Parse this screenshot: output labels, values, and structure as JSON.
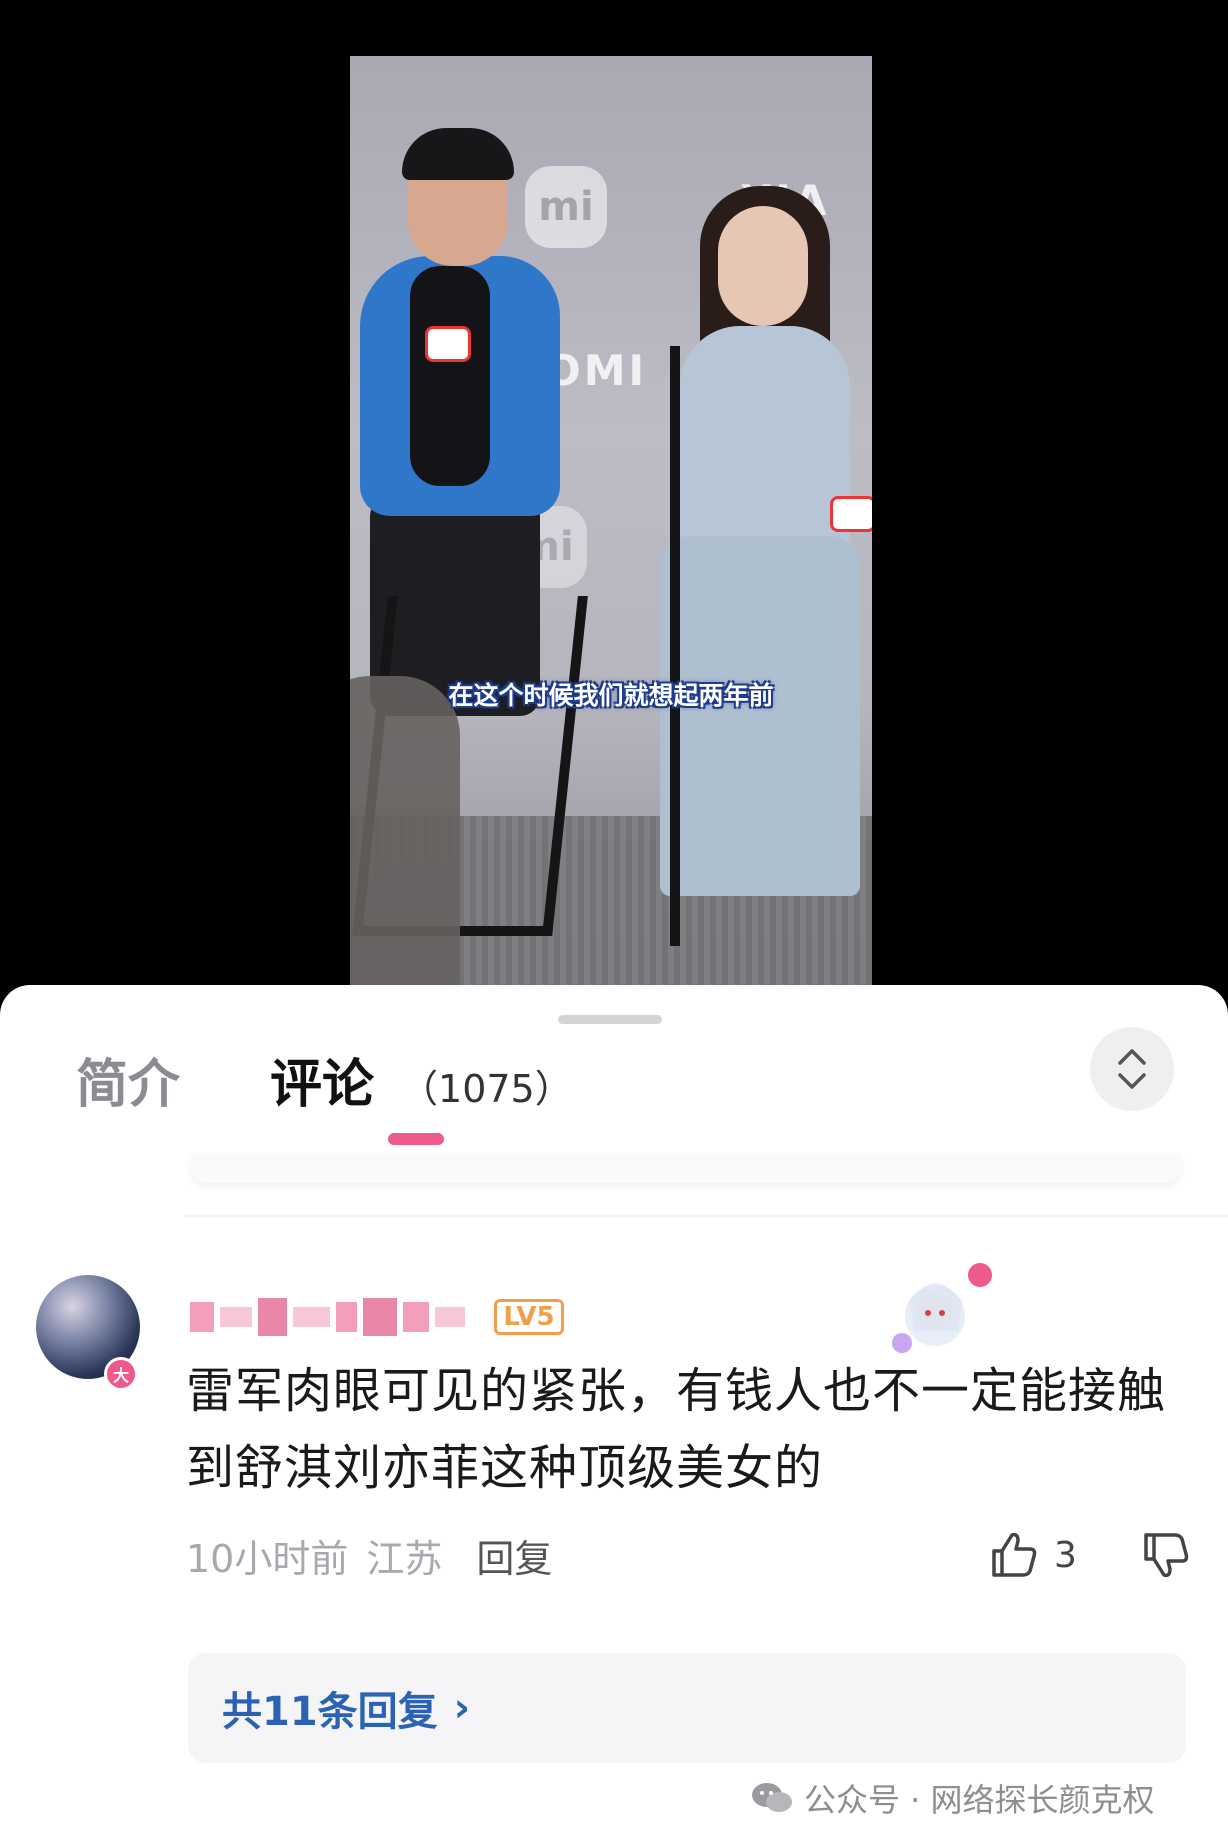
{
  "video": {
    "caption": "在这个时候我们就想起两年前",
    "brand_text_1": "XIA",
    "brand_text_2": "OMI",
    "logo_text": "mi"
  },
  "tabs": {
    "intro_label": "简介",
    "comments_label": "评论",
    "comments_count": "（1075）"
  },
  "comment": {
    "level_badge": "LV5",
    "avatar_badge": "大",
    "text": "雷军肉眼可见的紧张，有钱人也不一定能接触到舒淇刘亦菲这种顶级美女的",
    "time": "10小时前",
    "location": "江苏",
    "reply_label": "回复",
    "like_count": "3",
    "replies_label": "共11条回复",
    "replies_chevron": "›"
  },
  "watermark": {
    "text": "公众号 · 网络探长颜克权"
  },
  "colors": {
    "accent_pink": "#ee5a8a",
    "link_blue": "#2b62b3",
    "level_orange": "#f0a04b"
  },
  "icons": [
    "expand-collapse-icon",
    "thumbs-up-icon",
    "thumbs-down-icon",
    "chevron-right-icon",
    "wechat-icon"
  ]
}
